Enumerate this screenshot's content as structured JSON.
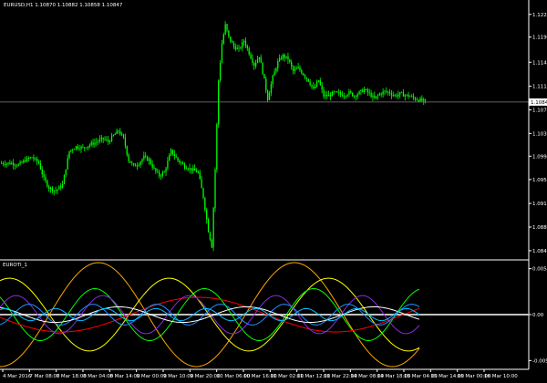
{
  "main_title": "EURUSD,H1 1.10870 1.10882 1.10858 1.10847",
  "indicator_title": "EUROTI_1",
  "colors": {
    "background": "#000000",
    "candle_bull": "#00ff00",
    "axis_text": "#ffffff",
    "price_line": "#808080",
    "indicator_zero": "#c0c0c0",
    "waves": [
      "#ffa500",
      "#ffff00",
      "#00ff00",
      "#ff0000",
      "#8a2be2",
      "#1e90ff",
      "#ffffff",
      "#00bfff"
    ]
  },
  "chart_data": [
    {
      "type": "candlestick",
      "title": "EURUSD,H1 1.10870 1.10882 1.10858 1.10847",
      "y_ticks": [
        "1.12275",
        "1.11905",
        "1.11495",
        "1.11105",
        "1.10720",
        "1.10335",
        "1.09965",
        "1.09585",
        "1.09195",
        "1.08810",
        "1.08425"
      ],
      "current_price": "1.10847",
      "ylim": [
        1.0832,
        1.1245
      ],
      "x_ticks": [
        "4 Mar 2016",
        "7 Mar 08:00",
        "7 Mar 18:00",
        "8 Mar 04:00",
        "8 Mar 14:00",
        "9 Mar 00:00",
        "9 Mar 10:00",
        "9 Mar 20:00",
        "10 Mar 06:00",
        "10 Mar 16:00",
        "11 Mar 02:00",
        "11 Mar 12:00",
        "11 Mar 22:00",
        "14 Mar 08:00",
        "14 Mar 18:00",
        "15 Mar 04:00",
        "15 Mar 14:00",
        "16 Mar 00:00",
        "16 Mar 10:00"
      ],
      "close_path": [
        [
          0,
          1.0985
        ],
        [
          6,
          1.0985
        ],
        [
          10,
          1.0982
        ],
        [
          14,
          1.099
        ],
        [
          18,
          1.0995
        ],
        [
          22,
          1.0985
        ],
        [
          25,
          1.096
        ],
        [
          28,
          1.0945
        ],
        [
          32,
          1.094
        ],
        [
          36,
          1.095
        ],
        [
          40,
          1.1005
        ],
        [
          44,
          1.1012
        ],
        [
          48,
          1.101
        ],
        [
          52,
          1.1015
        ],
        [
          56,
          1.102
        ],
        [
          60,
          1.1025
        ],
        [
          63,
          1.102
        ],
        [
          66,
          1.103
        ],
        [
          69,
          1.1038
        ],
        [
          72,
          1.1025
        ],
        [
          75,
          1.099
        ],
        [
          78,
          1.098
        ],
        [
          81,
          1.0985
        ],
        [
          84,
          1.0995
        ],
        [
          87,
          1.099
        ],
        [
          90,
          1.0975
        ],
        [
          93,
          1.0965
        ],
        [
          96,
          1.097
        ],
        [
          100,
          1.1005
        ],
        [
          104,
          1.099
        ],
        [
          108,
          1.098
        ],
        [
          112,
          1.0975
        ],
        [
          116,
          1.097
        ],
        [
          119,
          1.093
        ],
        [
          122,
          1.0875
        ],
        [
          124,
          1.085
        ],
        [
          126,
          1.0975
        ],
        [
          128,
          1.112
        ],
        [
          130,
          1.118
        ],
        [
          132,
          1.121
        ],
        [
          134,
          1.119
        ],
        [
          137,
          1.1175
        ],
        [
          140,
          1.117
        ],
        [
          143,
          1.1185
        ],
        [
          146,
          1.1165
        ],
        [
          149,
          1.1145
        ],
        [
          152,
          1.116
        ],
        [
          155,
          1.112
        ],
        [
          157,
          1.109
        ],
        [
          160,
          1.1125
        ],
        [
          163,
          1.115
        ],
        [
          166,
          1.116
        ],
        [
          169,
          1.1155
        ],
        [
          172,
          1.1135
        ],
        [
          175,
          1.114
        ],
        [
          178,
          1.113
        ],
        [
          181,
          1.112
        ],
        [
          184,
          1.1105
        ],
        [
          187,
          1.112
        ],
        [
          190,
          1.1095
        ],
        [
          193,
          1.1095
        ],
        [
          196,
          1.11
        ],
        [
          199,
          1.1098
        ],
        [
          202,
          1.1096
        ],
        [
          205,
          1.11
        ],
        [
          208,
          1.1095
        ],
        [
          211,
          1.11
        ],
        [
          214,
          1.1105
        ],
        [
          217,
          1.1098
        ],
        [
          220,
          1.109
        ],
        [
          223,
          1.1098
        ],
        [
          226,
          1.1102
        ],
        [
          229,
          1.11
        ],
        [
          232,
          1.1095
        ],
        [
          235,
          1.1098
        ],
        [
          238,
          1.1096
        ],
        [
          241,
          1.1094
        ],
        [
          244,
          1.109
        ],
        [
          247,
          1.1088
        ],
        [
          250,
          1.1085
        ]
      ]
    },
    {
      "type": "line",
      "title": "EUROTI_1",
      "y_ticks": [
        "0.0053",
        "0.00",
        "-0.0053"
      ],
      "ylim": [
        -0.006,
        0.006
      ],
      "series": [
        {
          "color": "#ffa500",
          "amplitude": 0.006,
          "period": 215,
          "phase": 4.7
        },
        {
          "color": "#ffff00",
          "amplitude": 0.0042,
          "period": 175,
          "phase": 1.2
        },
        {
          "color": "#00ff00",
          "amplitude": 0.003,
          "period": 120,
          "phase": 2.4
        },
        {
          "color": "#ff0000",
          "amplitude": 0.002,
          "period": 300,
          "phase": 3.3
        },
        {
          "color": "#8a2be2",
          "amplitude": 0.0022,
          "period": 95,
          "phase": 0.4
        },
        {
          "color": "#1e90ff",
          "amplitude": 0.0012,
          "period": 70,
          "phase": 5.0
        },
        {
          "color": "#ffffff",
          "amplitude": 0.0009,
          "period": 140,
          "phase": 2.0
        },
        {
          "color": "#00bfff",
          "amplitude": 0.0007,
          "period": 55,
          "phase": 0.9
        }
      ]
    }
  ]
}
